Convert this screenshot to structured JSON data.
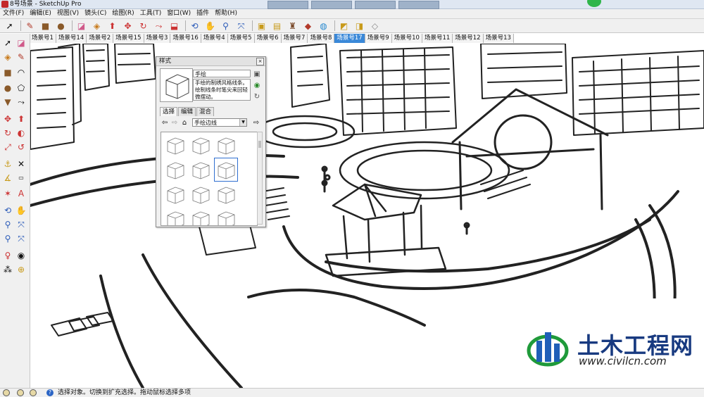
{
  "window": {
    "title": "8号场景 - SketchUp Pro"
  },
  "menu": [
    "文件(F)",
    "编辑(E)",
    "视图(V)",
    "镜头(C)",
    "绘图(R)",
    "工具(T)",
    "窗口(W)",
    "插件",
    "帮助(H)"
  ],
  "toolbar": {
    "icons": [
      "select-arrow-icon",
      "pencil-icon",
      "rectangle-icon",
      "circle-icon",
      "eraser-icon",
      "paint-bucket-icon",
      "push-pull-icon",
      "move-icon",
      "rotate-icon",
      "follow-me-icon",
      "offset-icon",
      "orbit-icon",
      "pan-icon",
      "zoom-icon",
      "zoom-extents-icon",
      "get-models-icon",
      "share-model-icon",
      "component-icon",
      "ruby-icon",
      "sandbox-icon",
      "style-icon"
    ]
  },
  "scene_tabs": [
    "场景号1",
    "场景号14",
    "场景号2",
    "场景号15",
    "场景号3",
    "场景号16",
    "场景号4",
    "场景号5",
    "场景号6",
    "场景号7",
    "场景号8",
    "场景号17",
    "场景号9",
    "场景号10",
    "场景号11",
    "场景号12",
    "场景号13"
  ],
  "active_scene_tab": "场景号17",
  "left_tools": [
    "select-icon",
    "eraser-icon",
    "paint-icon",
    "line-icon",
    "rectangle-icon",
    "arc-icon",
    "circle-icon",
    "polygon-icon",
    "push-pull-icon",
    "follow-me-icon",
    "move-icon",
    "rotate-icon",
    "scale-icon",
    "offset-icon",
    "tape-measure-icon",
    "dimension-icon",
    "protractor-icon",
    "text-icon",
    "axes-icon",
    "3d-text-icon",
    "orbit-icon",
    "pan-icon",
    "zoom-icon",
    "zoom-window-icon",
    "zoom-extents-icon",
    "previous-view-icon",
    "position-camera-icon",
    "look-around-icon",
    "walk-icon",
    "section-plane-icon"
  ],
  "styles_dialog": {
    "title": "样式",
    "style_name": "手绘",
    "description": "手绘的制绣风格线条。绘制线条时笔尖来回轻微摆动。",
    "tabs": [
      "选择",
      "编辑",
      "混合"
    ],
    "collection": "手绘边线",
    "thumbnail_count": 12,
    "selected_thumbnail": 6
  },
  "status": {
    "text": "选择对象。切换到扩充选择。拖动鼠标选择多项"
  },
  "watermark": {
    "name": "土木工程网",
    "url": "www.civilcn.com"
  }
}
